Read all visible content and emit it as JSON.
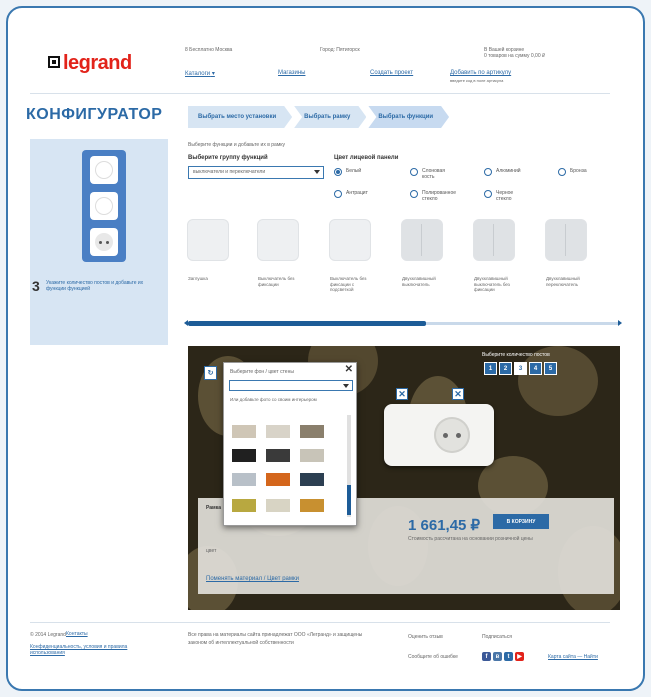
{
  "header": {
    "logo_text": "legrand",
    "phone": "8 Бесплатно Москва",
    "city_label": "Город: Пятигорск",
    "cart_info": "В Вашей корзине",
    "cart_sum": "0 товаров на сумму 0,00 ₽",
    "catalog_link": "Каталоги",
    "shops_link": "Магазины",
    "create_project": "Создать проект",
    "add_project": "Добавить по артикулу",
    "add_project_sub": "введите код в поле артикула"
  },
  "configurator": {
    "title": "КОНФИГУРАТОР",
    "steps": [
      "Выбрать место установки",
      "Выбрать рамку",
      "Выбрать функции"
    ],
    "hint": "Выберите функции и добавьте их в рамку",
    "group_label": "Выберите группу функций",
    "group_value": "выключатели и переключатели",
    "color_label": "Цвет лицевой панели",
    "colors": [
      {
        "label": "Белый",
        "selected": true
      },
      {
        "label": "Слоновая кость",
        "selected": false
      },
      {
        "label": "Алюминий",
        "selected": false
      },
      {
        "label": "Антрацит",
        "selected": false
      },
      {
        "label": "Полированное стекло",
        "selected": false
      },
      {
        "label": "Черное стекло",
        "selected": false
      },
      {
        "label": "Бронза",
        "selected": false
      }
    ],
    "step_number": "3",
    "step_text": "Укажите количество постов и добавьте их функции функцией",
    "functions": [
      "Заглушка",
      "Выключатель без фиксации",
      "Выключатель без фиксации с подсветкой",
      "Двухклавишный выключатель",
      "Двухклавишный выключатель без фиксации",
      "Двухклавишный переключатель"
    ]
  },
  "preview": {
    "qty_label": "Выберите количество постов",
    "qty_options": [
      "1",
      "2",
      "3",
      "4",
      "5"
    ],
    "qty_selected": 2,
    "price": "1 661,45 ₽",
    "cart_button": "В корзину",
    "price_note": "Стоимость рассчитана на основании розничной цены",
    "note_left": "Рамка",
    "note_left2": "цвет",
    "material_link": "Поменять материал / Цвет рамки"
  },
  "popup": {
    "title": "Выберите фон / цвет стены",
    "tab_text": "Или добавьте фото со своим интерьером",
    "swatches": [
      "#cfc6b6",
      "#d8d3c8",
      "#8a7f6c",
      "#202020",
      "#3a3a3a",
      "#c8c4b8",
      "#b8c0c8",
      "#d4661c",
      "#2c3f52",
      "#b8a840",
      "#d8d4c4",
      "#c89030"
    ]
  },
  "footer": {
    "copyright": "© 2014 Legrand",
    "contacts": "Контакты",
    "policy": "Конфиденциальность, условия и правила использования",
    "address": "Все права на материалы сайта принадлежат ООО «Легранд» и защищены",
    "address2": "законом об интеллектуальной собственности",
    "share_label": "Оценить отзыв",
    "subscribe": "Подписаться",
    "social_label": "Сообщите об ошибке",
    "map_link": "Карта сайта — Найти"
  }
}
